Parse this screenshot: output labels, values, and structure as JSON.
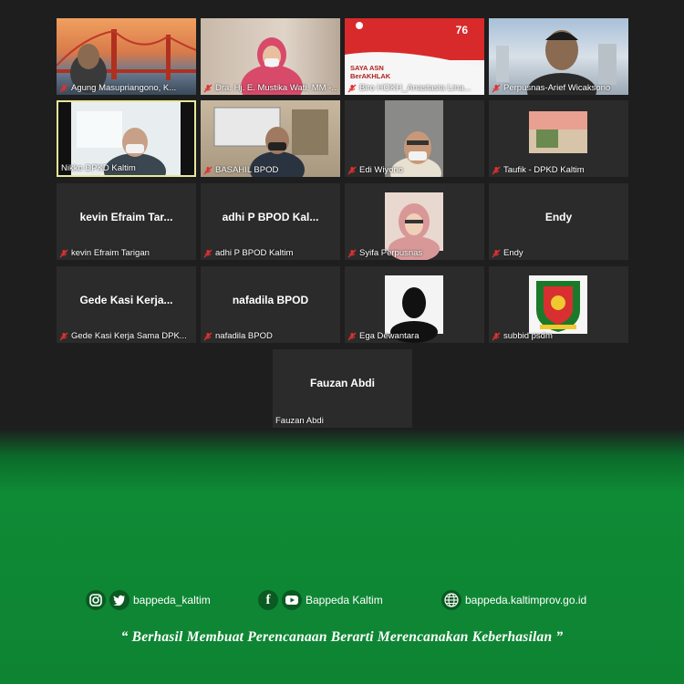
{
  "participants": [
    {
      "name": "Agung Masupriangono, K...",
      "muted": true,
      "video": "bridge"
    },
    {
      "name": "Dra. Hj. E. Mustika Wati, MM -...",
      "muted": true,
      "video": "woman-pink"
    },
    {
      "name": "Biro HOKH_Anastasia Lina...",
      "muted": true,
      "video": "banner",
      "banner_text": "SAYA ASN BerAKHLAK",
      "banner_badge": "76"
    },
    {
      "name": "Perpusnas-Arief Wicaksono",
      "muted": true,
      "video": "man-city"
    },
    {
      "name": "Nikko DPKD Kaltim",
      "muted": false,
      "video": "man-mask",
      "active": true
    },
    {
      "name": "BASAHIL BPOD",
      "muted": true,
      "video": "office"
    },
    {
      "name": "Edi Wiyono",
      "muted": true,
      "video": "man-glasses"
    },
    {
      "name": "Taufik - DPKD Kaltim",
      "muted": true,
      "video": "small-photo"
    },
    {
      "name": "kevin Efraim Tarigan",
      "display": "kevin Efraim Tar...",
      "muted": true,
      "video": "none"
    },
    {
      "name": "adhi P BPOD Kaltim",
      "display": "adhi P BPOD Kal...",
      "muted": true,
      "video": "none"
    },
    {
      "name": "Syifa Perpusnas",
      "muted": true,
      "video": "hijab"
    },
    {
      "name": "Endy",
      "display": "Endy",
      "muted": true,
      "video": "none"
    },
    {
      "name": "Gede Kasi Kerja Sama DPK...",
      "display": "Gede Kasi Kerja...",
      "muted": true,
      "video": "none"
    },
    {
      "name": "nafadila BPOD",
      "display": "nafadila BPOD",
      "muted": true,
      "video": "none"
    },
    {
      "name": "Ega Dewantara",
      "muted": true,
      "video": "silhouette"
    },
    {
      "name": "subbid psdm",
      "muted": true,
      "video": "emblem"
    },
    {
      "name": "Fauzan Abdi",
      "display": "Fauzan Abdi",
      "muted": false,
      "video": "none"
    }
  ],
  "footer": {
    "twitter_handle": "bappeda_kaltim",
    "facebook_youtube": "Bappeda Kaltim",
    "website": "bappeda.kaltimprov.go.id",
    "tagline": "“ Berhasil  Membuat Perencanaan Berarti Merencanakan Keberhasilan ”"
  },
  "colors": {
    "background": "#1e1e1e",
    "tile": "#2b2b2b",
    "active_border": "#e8e89a",
    "green": "#0f8a35",
    "muted_icon": "#e03030"
  }
}
